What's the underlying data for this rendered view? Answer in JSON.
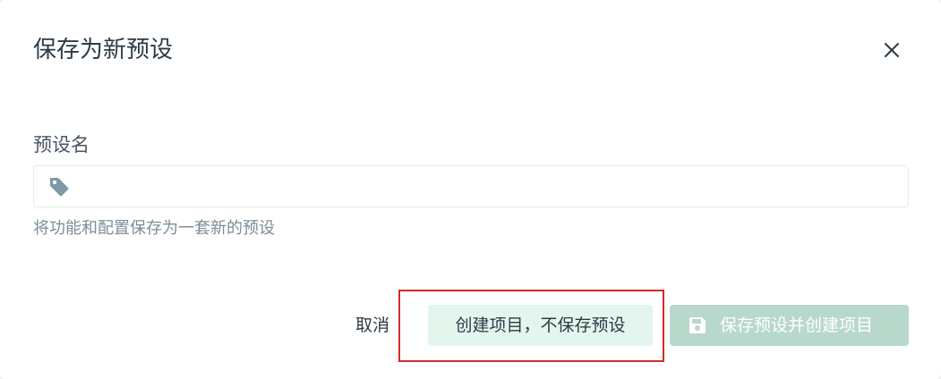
{
  "dialog": {
    "title": "保存为新预设",
    "close_icon": "close-icon"
  },
  "form": {
    "label": "预设名",
    "input": {
      "value": "",
      "placeholder": "",
      "icon": "tag-icon"
    },
    "help": "将功能和配置保存为一套新的预设"
  },
  "actions": {
    "cancel_label": "取消",
    "create_no_save_label": "创建项目，不保存预设",
    "save_and_create_label": "保存预设并创建项目",
    "save_icon": "floppy-disk-icon"
  },
  "colors": {
    "accent_light": "#e3f5ed",
    "accent_disabled": "#b8d8cb",
    "highlight": "#d62a2a",
    "text": "#2d3b45",
    "muted": "#7b8e96"
  }
}
